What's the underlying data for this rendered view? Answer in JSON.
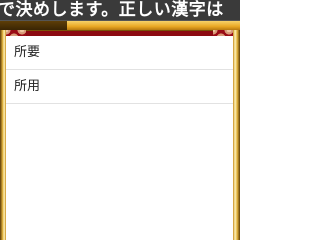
{
  "question": {
    "text": "で決めします。正しい漢字は"
  },
  "timer": {
    "remaining_fraction": 0.28
  },
  "answers": [
    {
      "label": "所要"
    },
    {
      "label": "所用"
    }
  ],
  "colors": {
    "banner": "#3a3a3a",
    "progress_gold": "#e9a824",
    "progress_dark": "#3a2504",
    "pattern_red": "#9a0c16",
    "panel": "#ffffff"
  }
}
